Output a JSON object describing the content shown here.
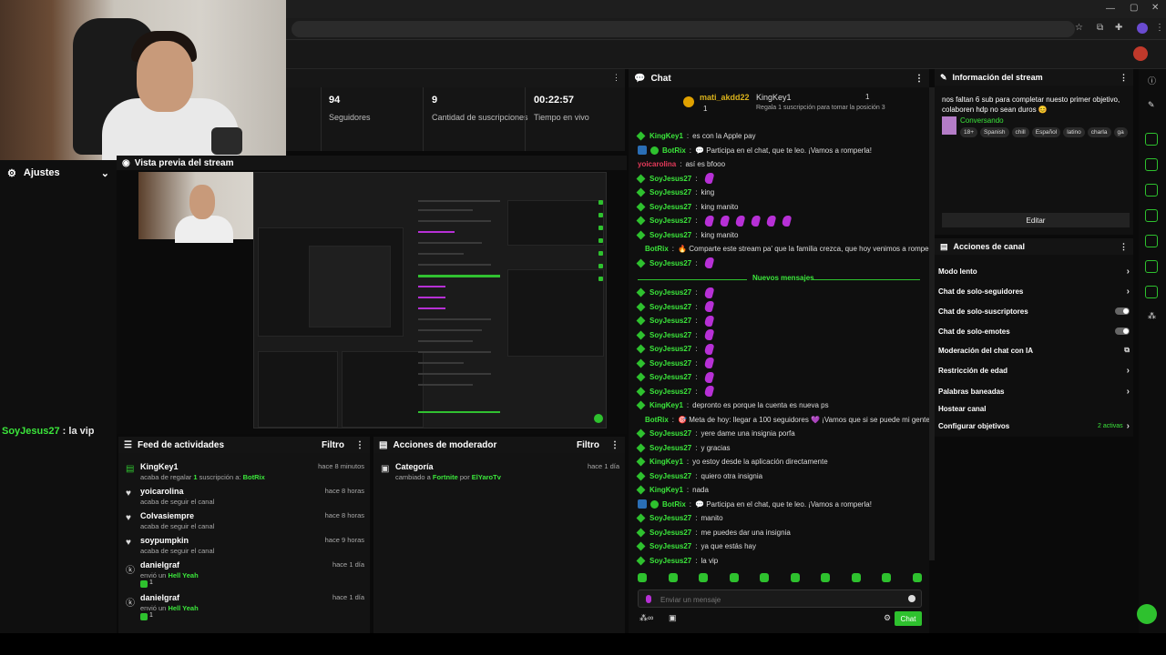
{
  "app": {
    "chat_title": "Chat",
    "info_title": "Información del stream",
    "actions_title": "Acciones de canal",
    "preview_title": "Vista previa del stream",
    "settings_label": "Ajustes"
  },
  "stats": [
    {
      "value": "94",
      "label": "Seguidores"
    },
    {
      "value": "9",
      "label": "Cantidad de suscripciones"
    },
    {
      "value": "00:22:57",
      "label": "Tiempo en vivo"
    }
  ],
  "webcam_overlay": {
    "user": "SoyJesus27",
    "text": ": la vip"
  },
  "feed": {
    "title": "Feed de actividades",
    "filter": "Filtro",
    "items": [
      {
        "icon": "subscription-icon",
        "name": "KingKey1",
        "desc_pre": "acaba de regalar ",
        "desc_num": "1",
        "desc_mid": " suscripción a: ",
        "desc_hl": "BotRix",
        "time": "hace 8 minutos"
      },
      {
        "icon": "heart-icon",
        "name": "yoicarolina",
        "desc": "acaba de seguir el canal",
        "time": "hace 8 horas"
      },
      {
        "icon": "heart-icon",
        "name": "Colvasiempre",
        "desc": "acaba de seguir el canal",
        "time": "hace 8 horas"
      },
      {
        "icon": "heart-icon",
        "name": "soypumpkin",
        "desc": "acaba de seguir el canal",
        "time": "hace 9 horas"
      },
      {
        "icon": "kick-icon",
        "name": "danielgraf",
        "desc_pre": "envió un ",
        "desc_hl": "Hell Yeah",
        "time": "hace 1 día",
        "count": "1"
      },
      {
        "icon": "kick-icon",
        "name": "danielgraf",
        "desc_pre": "envió un ",
        "desc_hl": "Hell Yeah",
        "time": "hace 1 día",
        "count": "1"
      }
    ]
  },
  "moderator": {
    "title": "Acciones de moderador",
    "filter": "Filtro",
    "item": {
      "name": "Categoría",
      "desc_pre": "cambiado a ",
      "desc_hl": "Fortnite",
      "desc_mid": " por ",
      "desc_hl2": "ElYaroTv",
      "time": "hace 1 día"
    }
  },
  "pinned": {
    "user1": "mati_akdd22",
    "user1_count": "1",
    "user2": "KingKey1",
    "user2_count": "1",
    "text": "Regala 1 suscripción para tomar la posición 3"
  },
  "chat_messages": [
    {
      "user": "KingKey1",
      "color": "#3be63b",
      "text": "es con la Apple pay"
    },
    {
      "user": "BotRix",
      "bot": true,
      "color": "#3be63b",
      "text": "💬 Participa en el chat, que te leo. ¡Vamos a romperla!"
    },
    {
      "user": "yoicarolina",
      "color": "#e53a5a",
      "text": "así es bfooo",
      "plain": true
    },
    {
      "user": "SoyJesus27",
      "color": "#3be63b",
      "text": "",
      "emotes": 1
    },
    {
      "user": "SoyJesus27",
      "color": "#3be63b",
      "text": "king"
    },
    {
      "user": "SoyJesus27",
      "color": "#3be63b",
      "text": "king manito"
    },
    {
      "user": "SoyJesus27",
      "color": "#3be63b",
      "text": "",
      "emotes": 6
    },
    {
      "user": "SoyJesus27",
      "color": "#3be63b",
      "text": "king manito"
    },
    {
      "user": "BotRix",
      "bot": true,
      "color": "#3be63b",
      "text": "🔥 Comparte este stream pa' que la familia crezca, que hoy venimos a romperla 🚀"
    },
    {
      "user": "SoyJesus27",
      "color": "#3be63b",
      "text": "",
      "emotes": 1
    }
  ],
  "new_label": "Nuevos mensajes",
  "chat_messages_new": [
    {
      "user": "SoyJesus27",
      "color": "#3be63b",
      "text": "",
      "emotes": 1
    },
    {
      "user": "SoyJesus27",
      "color": "#3be63b",
      "text": "",
      "emotes": 1
    },
    {
      "user": "SoyJesus27",
      "color": "#3be63b",
      "text": "",
      "emotes": 1
    },
    {
      "user": "SoyJesus27",
      "color": "#3be63b",
      "text": "",
      "emotes": 1
    },
    {
      "user": "SoyJesus27",
      "color": "#3be63b",
      "text": "",
      "emotes": 1
    },
    {
      "user": "SoyJesus27",
      "color": "#3be63b",
      "text": "",
      "emotes": 1
    },
    {
      "user": "SoyJesus27",
      "color": "#3be63b",
      "text": "",
      "emotes": 1
    },
    {
      "user": "SoyJesus27",
      "color": "#3be63b",
      "text": "",
      "emotes": 1
    },
    {
      "user": "KingKey1",
      "color": "#3be63b",
      "text": "depronto es porque la cuenta es nueva ps"
    },
    {
      "user": "BotRix",
      "bot": true,
      "color": "#3be63b",
      "text": "🎯 Meta de hoy: llegar a 100 seguidores 💜 ¡Vamos que si se puede mi gente!"
    },
    {
      "user": "SoyJesus27",
      "color": "#3be63b",
      "text": "yere dame una insignia porfa"
    },
    {
      "user": "SoyJesus27",
      "color": "#3be63b",
      "text": "y gracias"
    },
    {
      "user": "KingKey1",
      "color": "#3be63b",
      "text": "yo estoy desde la aplicación directamente"
    },
    {
      "user": "SoyJesus27",
      "color": "#3be63b",
      "text": "quiero otra insignia"
    },
    {
      "user": "KingKey1",
      "color": "#3be63b",
      "text": "nada"
    },
    {
      "user": "BotRix",
      "bot": true,
      "color": "#3be63b",
      "text": "💬 Participa en el chat, que te leo. ¡Vamos a romperla!"
    },
    {
      "user": "SoyJesus27",
      "color": "#3be63b",
      "text": "manito"
    },
    {
      "user": "SoyJesus27",
      "color": "#3be63b",
      "text": "me puedes dar una insignia"
    },
    {
      "user": "SoyJesus27",
      "color": "#3be63b",
      "text": "ya que estás hay"
    },
    {
      "user": "SoyJesus27",
      "color": "#3be63b",
      "text": "la vip"
    }
  ],
  "chat_input": {
    "placeholder": "Enviar un mensaje",
    "send": "Chat"
  },
  "info": {
    "title": "nos faltan 6 sub para completar nuesto primer objetivo, colaboren hdp no sean duros 😊",
    "category": "Conversando",
    "tags": [
      "18+",
      "Spanish",
      "chill",
      "Español",
      "latino",
      "charla",
      "ga"
    ],
    "edit": "Editar"
  },
  "actions": [
    {
      "label": "Modo lento",
      "type": "chevron"
    },
    {
      "label": "Chat de solo-seguidores",
      "type": "chevron"
    },
    {
      "label": "Chat de solo-suscriptores",
      "type": "toggle"
    },
    {
      "label": "Chat de solo-emotes",
      "type": "toggle"
    },
    {
      "label": "Moderación del chat con IA",
      "type": "link"
    },
    {
      "label": "Restricción de edad",
      "type": "chevron"
    },
    {
      "label": "Palabras baneadas",
      "type": "chevron"
    },
    {
      "label": "Hostear canal",
      "type": "none"
    },
    {
      "label": "Configurar objetivos",
      "type": "active",
      "active": "2 activas"
    }
  ],
  "colors": {
    "accent": "#2ec12e",
    "bg": "#0f0f0f",
    "bot": "#2a6eb5",
    "emote": "#b730d6"
  }
}
